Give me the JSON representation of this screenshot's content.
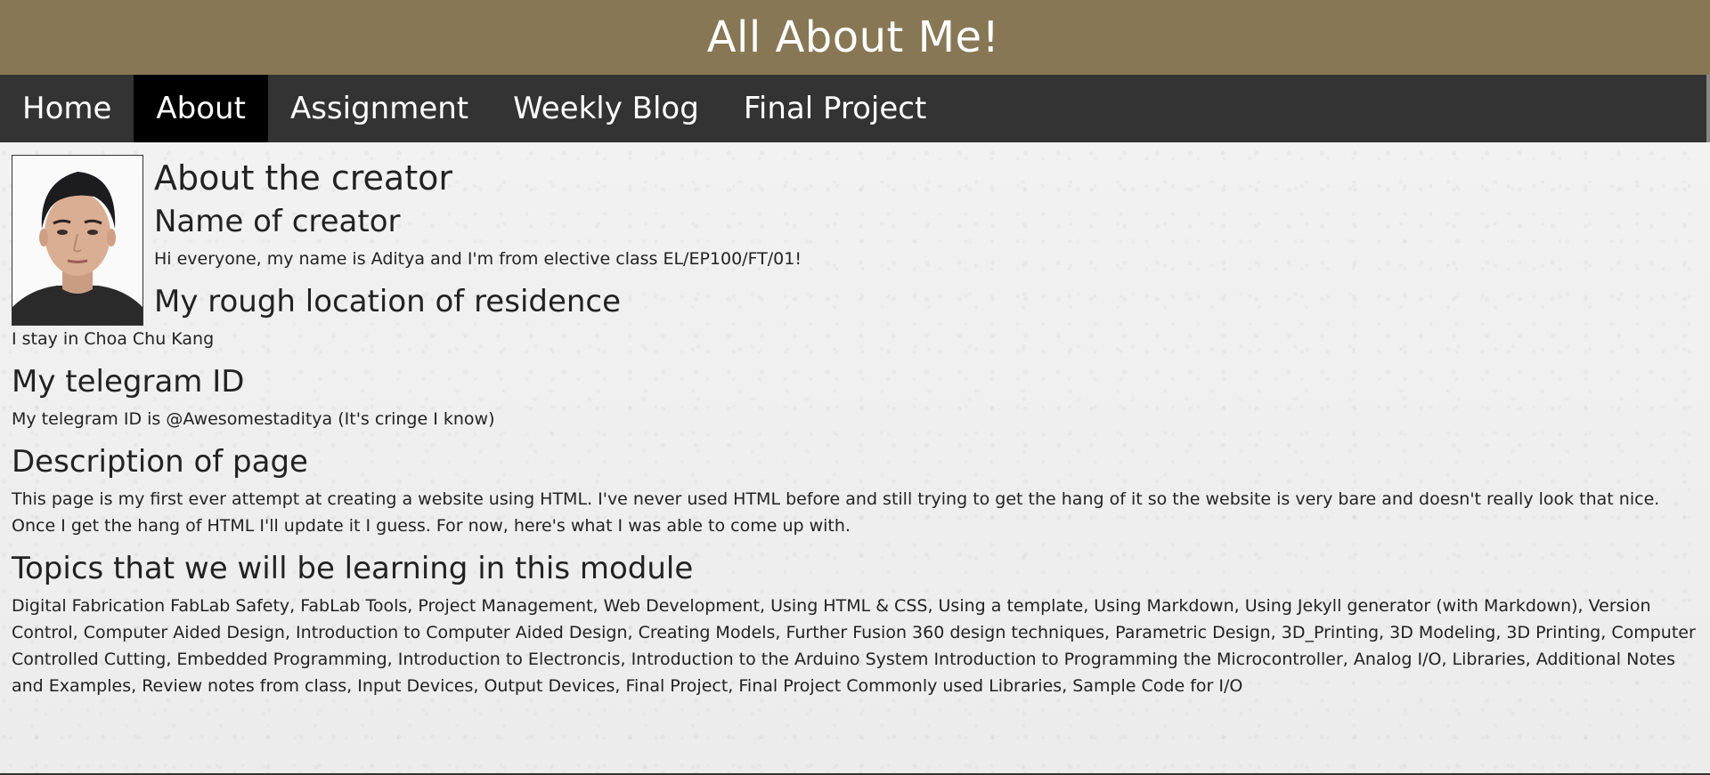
{
  "header": {
    "title": "All About Me!"
  },
  "nav": {
    "items": [
      {
        "label": "Home"
      },
      {
        "label": "About"
      },
      {
        "label": "Assignment"
      },
      {
        "label": "Weekly Blog"
      },
      {
        "label": "Final Project"
      }
    ],
    "active": "About"
  },
  "profile": {
    "photo_alt": "creator portrait"
  },
  "about": {
    "heading": "About the creator"
  },
  "name": {
    "heading": "Name of creator",
    "text": "Hi everyone, my name is Aditya and I'm from elective class EL/EP100/FT/01!"
  },
  "location": {
    "heading": "My rough location of residence",
    "text": "I stay in Choa Chu Kang"
  },
  "telegram": {
    "heading": "My telegram ID",
    "text": "My telegram ID is @Awesomestaditya (It's cringe I know)"
  },
  "description": {
    "heading": "Description of page",
    "text": "This page is my first ever attempt at creating a website using HTML. I've never used HTML before and still trying to get the hang of it so the website is very bare and doesn't really look that nice. Once I get the hang of HTML I'll update it I guess. For now, here's what I was able to come up with."
  },
  "topics": {
    "heading": "Topics that we will be learning in this module",
    "text": "Digital Fabrication FabLab Safety, FabLab Tools, Project Management, Web Development, Using HTML & CSS, Using a template, Using Markdown, Using Jekyll generator (with Markdown), Version Control, Computer Aided Design, Introduction to Computer Aided Design, Creating Models, Further Fusion 360 design techniques, Parametric Design, 3D_Printing, 3D Modeling, 3D Printing, Computer Controlled Cutting, Embedded Programming, Introduction to Electroncis, Introduction to the Arduino System Introduction to Programming the Microcontroller, Analog I/O, Libraries, Additional Notes and Examples, Review notes from class, Input Devices, Output Devices, Final Project, Final Project Commonly used Libraries, Sample Code for I/O"
  },
  "colors": {
    "header_bg": "#877754",
    "nav_bg": "#333333",
    "nav_active_bg": "#000000",
    "page_bg": "#f0f0f0"
  }
}
